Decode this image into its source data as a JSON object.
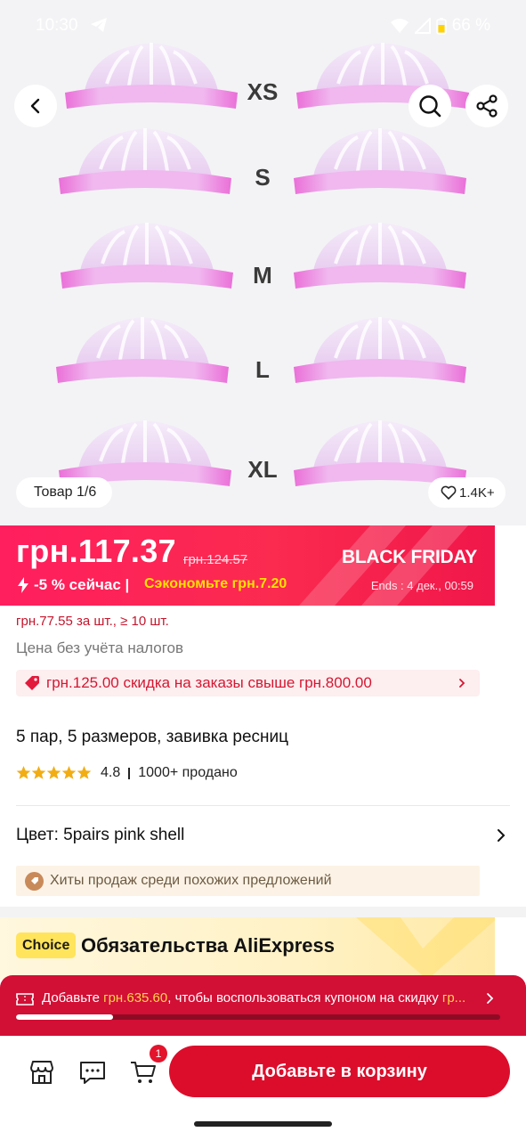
{
  "status_bar": {
    "time": "10:30",
    "battery": "66 %"
  },
  "gallery": {
    "size_labels": [
      "XS",
      "S",
      "M",
      "L",
      "XL"
    ],
    "counter": "Товар 1/6",
    "wishlist_count": "1.4K+"
  },
  "promo": {
    "price": "грн.117.37",
    "old_price": "грн.124.57",
    "event": "BLACK FRIDAY",
    "discount_now": "-5 % сейчас |",
    "savings": "Сэкономьте грн.7.20",
    "ends": "Ends :  4 дек., 00:59"
  },
  "details": {
    "bulk_price": "грн.77.55 за шт., ≥ 10 шт.",
    "tax_note": "Цена без учёта налогов",
    "coupon": "грн.125.00 скидка на заказы свыше грн.800.00",
    "title": "5 пар, 5 размеров, завивка ресниц",
    "rating": "4.8",
    "sold": "1000+ продано",
    "color_label": "Цвет: 5pairs pink shell",
    "hits": "Хиты продаж среди похожих предложений"
  },
  "choice": {
    "badge": "Choice",
    "title": "Обязательства AliExpress"
  },
  "add_bar": {
    "prefix": "Добавьте ",
    "amount": "грн.635.60",
    "middle": ", чтобы воспользоваться купоном на скидку ",
    "suffix": "гр...",
    "progress": 0.2
  },
  "action_bar": {
    "cart_count": "1",
    "add_to_cart": "Добавьте в корзину"
  },
  "colors": {
    "accent": "#dc0d2b",
    "promo": "#ff1e5e",
    "savings": "#ffe200",
    "choice_badge": "#ffe45c"
  }
}
